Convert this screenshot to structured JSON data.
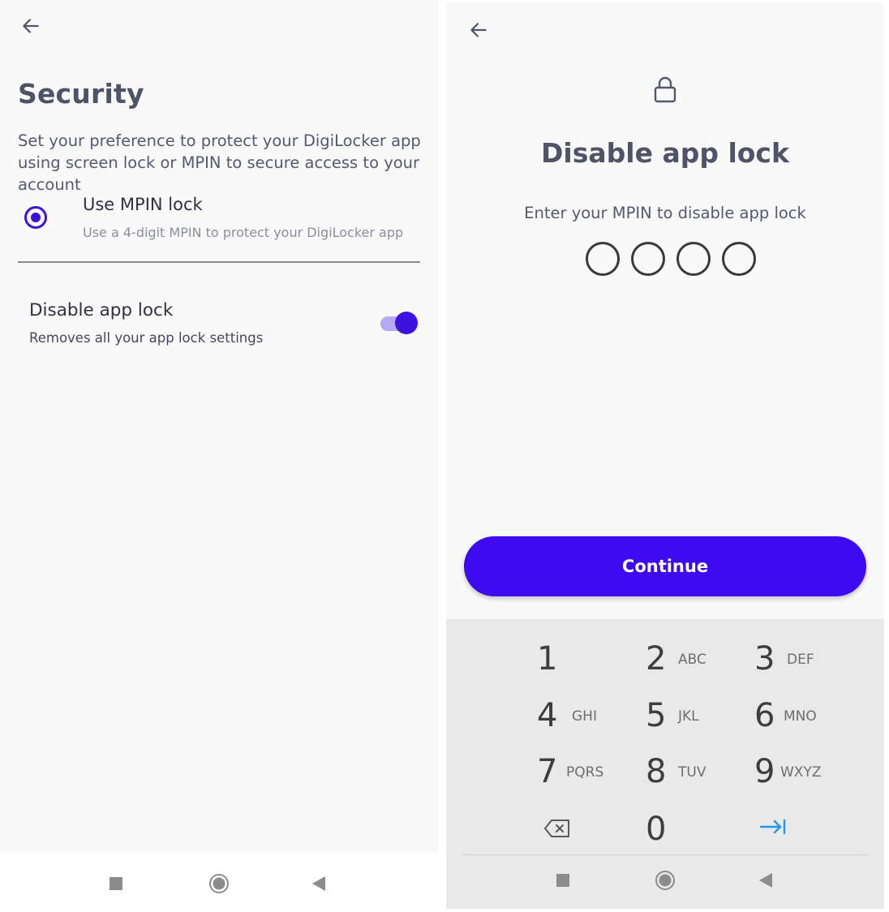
{
  "left": {
    "title": "Security",
    "description": "Set your preference to protect your DigiLocker app using screen lock or MPIN to secure access to your account",
    "mpin_option": {
      "title": "Use MPIN lock",
      "subtitle": "Use a 4-digit MPIN to protect your DigiLocker app",
      "selected": true
    },
    "disable_option": {
      "title": "Disable app lock",
      "subtitle": "Removes all your app lock settings",
      "toggle_on": true
    }
  },
  "right": {
    "title": "Disable app lock",
    "subtitle": "Enter your MPIN to disable app lock",
    "pin_length": 4,
    "continue_label": "Continue",
    "keypad": [
      {
        "digit": "1",
        "letters": ""
      },
      {
        "digit": "2",
        "letters": "ABC"
      },
      {
        "digit": "3",
        "letters": "DEF"
      },
      {
        "digit": "4",
        "letters": "GHI"
      },
      {
        "digit": "5",
        "letters": "JKL"
      },
      {
        "digit": "6",
        "letters": "MNO"
      },
      {
        "digit": "7",
        "letters": "PQRS"
      },
      {
        "digit": "8",
        "letters": "TUV"
      },
      {
        "digit": "9",
        "letters": "WXYZ"
      },
      {
        "digit": "0",
        "letters": ""
      }
    ]
  },
  "icons": {
    "back": "arrow-left-icon",
    "lock": "lock-icon",
    "backspace": "backspace-icon",
    "next": "tab-next-icon",
    "nav_recents": "square-icon",
    "nav_home": "circle-icon",
    "nav_back": "triangle-icon"
  },
  "colors": {
    "accent": "#3d0af2",
    "toggle_track": "#b7a8f5",
    "text_primary": "#2f3142",
    "text_secondary": "#8b8e9c",
    "keypad_bg": "#e9e9e9",
    "next_key": "#2196f3"
  }
}
